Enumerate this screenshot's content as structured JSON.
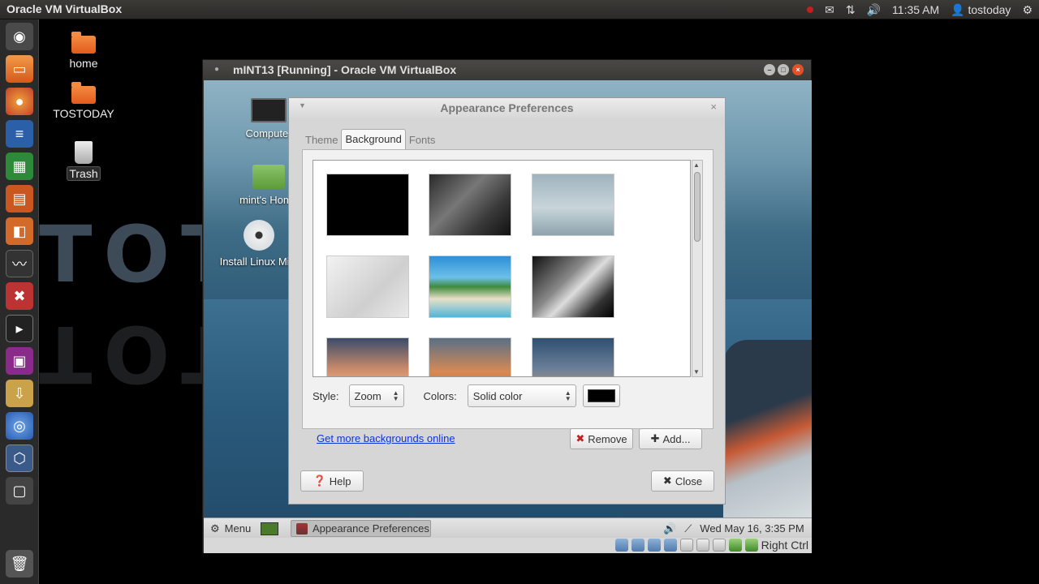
{
  "host": {
    "app_title": "Oracle VM VirtualBox",
    "clock": "11:35 AM",
    "user": "tostoday",
    "desktop_icons": [
      "home",
      "TOSTODAY",
      "Trash"
    ],
    "watermark_top": "TOTOSTODAY",
    "watermark_bottom": "TOTOSTODAY"
  },
  "vbox": {
    "title": "mINT13 [Running] - Oracle VM VirtualBox",
    "host_key": "Right Ctrl"
  },
  "guest": {
    "desktop_icons": [
      "Computer",
      "mint's Home",
      "Install Linux Mint"
    ],
    "panel": {
      "menu_label": "Menu",
      "task_label": "Appearance Preferences",
      "datetime": "Wed May 16,  3:35 PM"
    }
  },
  "dialog": {
    "title": "Appearance Preferences",
    "tabs": [
      "Theme",
      "Background",
      "Fonts"
    ],
    "active_tab": "Background",
    "style_label": "Style:",
    "style_value": "Zoom",
    "colors_label": "Colors:",
    "colors_value": "Solid color",
    "swatch_color": "#000000",
    "link_text": "Get more backgrounds online",
    "remove_label": "Remove",
    "add_label": "Add...",
    "help_label": "Help",
    "close_label": "Close"
  },
  "wallpapers": [
    {
      "name": "black",
      "bg": "#000000"
    },
    {
      "name": "dark-texture",
      "bg": "linear-gradient(135deg,#2a2a2a,#777 40%,#3a3a3a 70%,#111)"
    },
    {
      "name": "boat-sea",
      "bg": "linear-gradient(180deg,#9fb3bd 0%,#c8d5db 55%,#8ea3ac 100%)"
    },
    {
      "name": "linux-mint-3d",
      "bg": "linear-gradient(135deg,#f2f2f2,#cfcfcf 60%,#e9e9e9)"
    },
    {
      "name": "beach",
      "bg": "linear-gradient(180deg,#2e8fd6 0%,#6cc0e8 35%,#3f8a3c 50%,#e8e0c8 70%,#4fb6d8 100%)"
    },
    {
      "name": "waterfall",
      "bg": "linear-gradient(135deg,#111,#888 40%,#ddd 55%,#333 80%,#000)"
    },
    {
      "name": "sunset-1",
      "bg": "linear-gradient(180deg,#3a4c6a 0%,#c98a6a 50%,#e3a27a 70%,#2c3e58 100%)"
    },
    {
      "name": "sunset-2",
      "bg": "linear-gradient(180deg,#5a6f86 0%,#d68a55 55%,#c2602a 100%)"
    },
    {
      "name": "blue-gradient",
      "bg": "linear-gradient(180deg,#2f4f72 0%,#6b7f98 50%,#c99a7a 100%)"
    }
  ]
}
